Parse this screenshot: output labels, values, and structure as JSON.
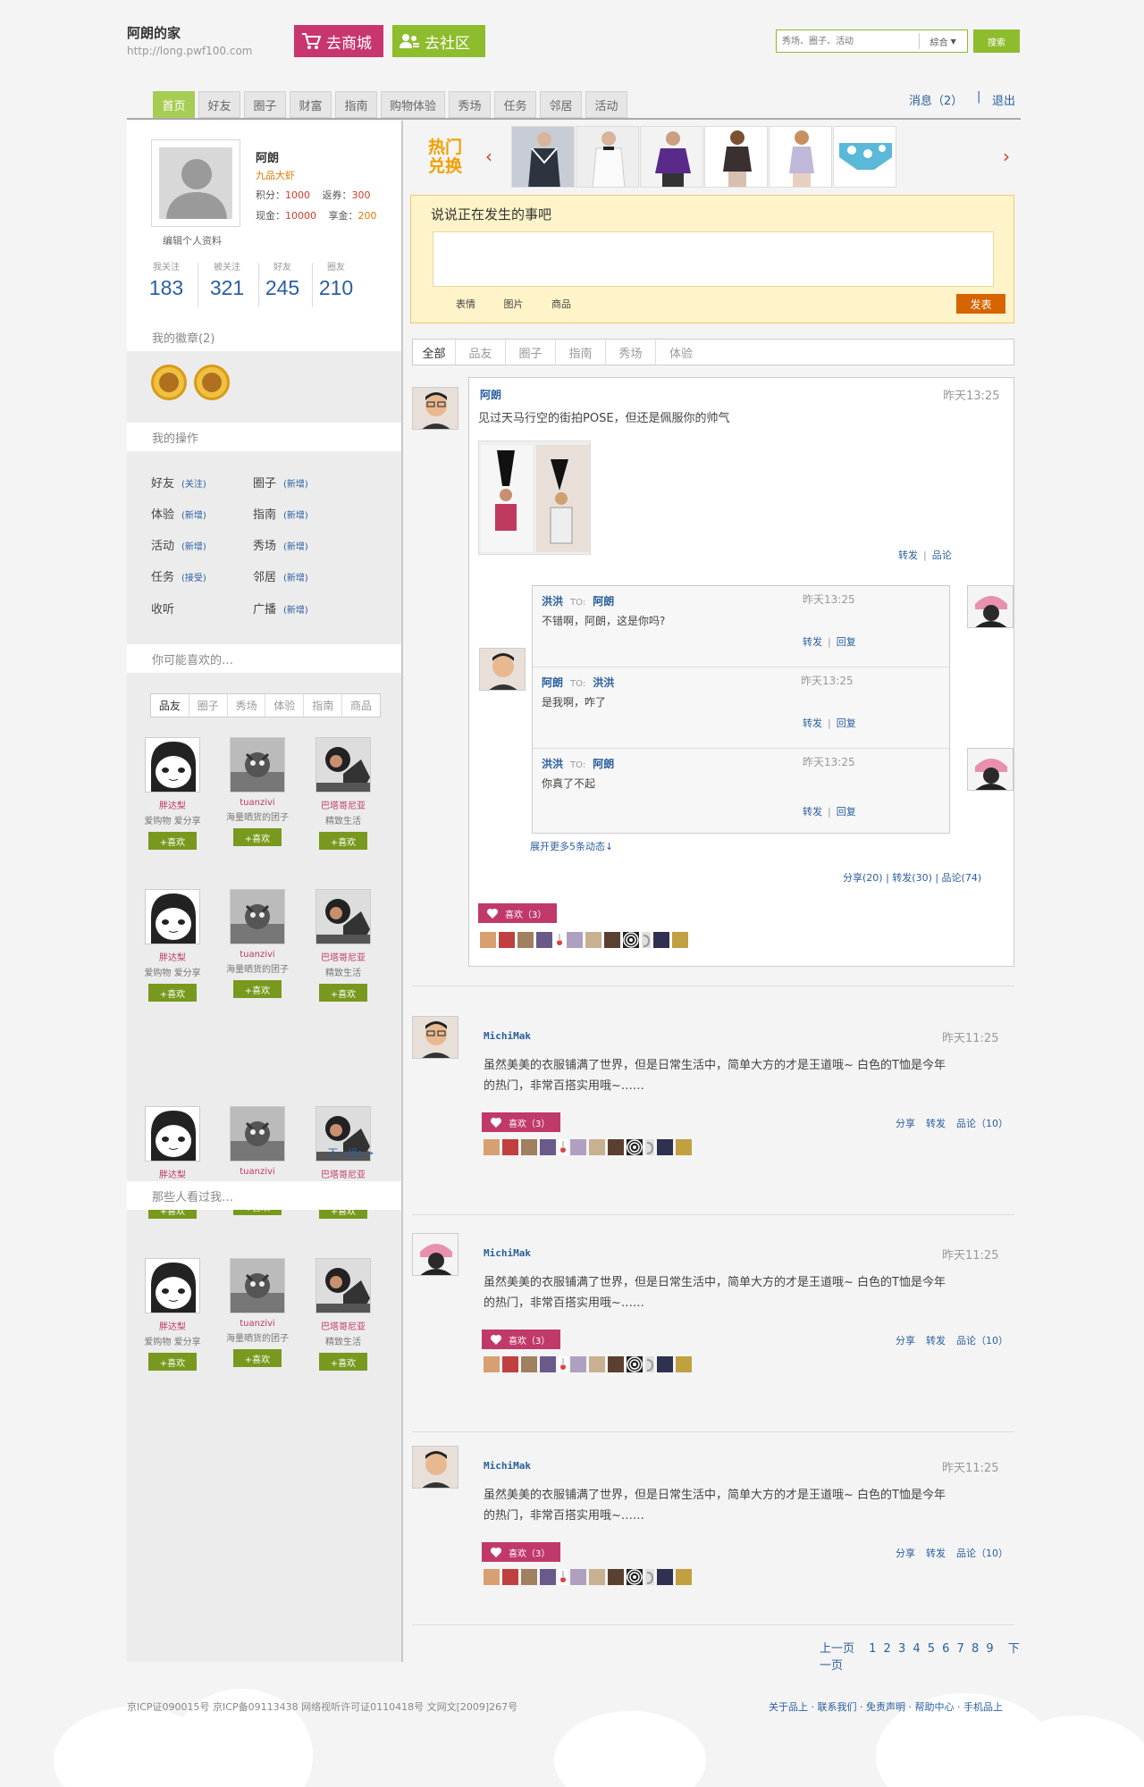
{
  "header": {
    "site_title": "阿朗的家",
    "site_url": "http://long.pwf100.com",
    "mall_button": "去商城",
    "community_button": "去社区",
    "search_placeholder": "秀场、圈子、活动",
    "search_scope": "綜合",
    "search_button": "搜索",
    "messages": "消息（2）",
    "separator": "|",
    "logout": "退出"
  },
  "nav": {
    "tabs": [
      "首页",
      "好友",
      "圈子",
      "财富",
      "指南",
      "购物体验",
      "秀场",
      "任务",
      "邻居",
      "活动"
    ],
    "active_index": 0
  },
  "profile": {
    "name": "阿朗",
    "level": "九品大虾",
    "points_label": "积分：",
    "points": "1000",
    "coupon_label": "返券：",
    "coupon": "300",
    "cash_label": "现金：",
    "cash": "10000",
    "enjoy_label": "享金：",
    "enjoy": "200",
    "edit_link": "编辑个人资料",
    "counts": [
      {
        "label": "我关注",
        "value": "183"
      },
      {
        "label": "被关注",
        "value": "321"
      },
      {
        "label": "好友",
        "value": "245"
      },
      {
        "label": "圈友",
        "value": "210"
      }
    ]
  },
  "sidebar": {
    "badges_title": "我的徽章(2)",
    "ops_title": "我的操作",
    "ops": [
      {
        "label": "好友",
        "action": "(关注)"
      },
      {
        "label": "圈子",
        "action": "(新增)"
      },
      {
        "label": "体验",
        "action": "(新增)"
      },
      {
        "label": "指南",
        "action": "(新增)"
      },
      {
        "label": "活动",
        "action": "(新增)"
      },
      {
        "label": "秀场",
        "action": "(新增)"
      },
      {
        "label": "任务",
        "action": "(接受)"
      },
      {
        "label": "邻居",
        "action": "(新增)"
      },
      {
        "label": "收听",
        "action": ""
      },
      {
        "label": "广播",
        "action": "(新增)"
      }
    ],
    "recommend_title": "你可能喜欢的…",
    "recommend_tabs": [
      "品友",
      "圈子",
      "秀场",
      "体验",
      "指南",
      "商品"
    ],
    "users": [
      {
        "name": "胖达梨",
        "desc": "爱购物 爱分享"
      },
      {
        "name": "tuanzivi",
        "desc": "海量晒货的团子"
      },
      {
        "name": "巴塔哥尼亚",
        "desc": "精致生活"
      }
    ],
    "like_button": "+喜欢",
    "next_group": "下一组>>",
    "visitors_title": "那些人看过我…"
  },
  "hot": {
    "label_line1": "热门",
    "label_line2": "兑换",
    "prev": "‹",
    "next": "›"
  },
  "post": {
    "title": "说说正在发生的事吧",
    "tools": [
      "表情",
      "图片",
      "商品"
    ],
    "submit": "发表"
  },
  "feed_tabs": [
    "全部",
    "品友",
    "圈子",
    "指南",
    "秀场",
    "体验"
  ],
  "feed1": {
    "author": "阿朗",
    "time": "昨天13:25",
    "text": "见过天马行空的街拍POSE，但还是佩服你的帅气",
    "forward": "转发",
    "comment": "品论",
    "replies": [
      {
        "from": "洪洪",
        "to_label": "TO:",
        "to": "阿朗",
        "time": "昨天13:25",
        "text": "不错啊，阿朗，这是你吗?"
      },
      {
        "from": "阿朗",
        "to_label": "TO:",
        "to": "洪洪",
        "time": "昨天13:25",
        "text": "是我啊，咋了"
      },
      {
        "from": "洪洪",
        "to_label": "TO:",
        "to": "阿朗",
        "time": "昨天13:25",
        "text": "你真了不起"
      }
    ],
    "reply_forward": "转发",
    "reply_reply": "回复",
    "more": "展开更多5条动态↓",
    "stats": "分享(20)  |  转发(30)  |  品论(74)",
    "like": "喜欢（3）"
  },
  "feeds": [
    {
      "author": "MichiMak",
      "time": "昨天11:25",
      "line1": "虽然美美的衣服铺满了世界，但是日常生活中，简单大方的才是王道哦~ 白色的T恤是今年",
      "line2": "的热门，非常百搭实用哦~……",
      "like": "喜欢（3）",
      "share": "分享",
      "forward": "转发",
      "comment": "品论（10）"
    },
    {
      "author": "MichiMak",
      "time": "昨天11:25",
      "line1": "虽然美美的衣服铺满了世界，但是日常生活中，简单大方的才是王道哦~ 白色的T恤是今年",
      "line2": "的热门，非常百搭实用哦~……",
      "like": "喜欢（3）",
      "share": "分享",
      "forward": "转发",
      "comment": "品论（10）"
    },
    {
      "author": "MichiMak",
      "time": "昨天11:25",
      "line1": "虽然美美的衣服铺满了世界，但是日常生活中，简单大方的才是王道哦~ 白色的T恤是今年",
      "line2": "的热门，非常百搭实用哦~……",
      "like": "喜欢（3）",
      "share": "分享",
      "forward": "转发",
      "comment": "品论（10）"
    }
  ],
  "pager": {
    "prev": "上一页",
    "pages": "1 2 3 4 5 6 7 8 9",
    "next": "下一页"
  },
  "footer": {
    "left": "京ICP证090015号  京ICP备09113438  网络视听许可证0110418号  文网文[2009]267号",
    "right": "关于品上 · 联系我们 · 免责声明 · 帮助中心 · 手机品上"
  },
  "colors": {
    "brand_green": "#8dbc2d",
    "brand_pink": "#c8366f",
    "link_blue": "#2a5f9e",
    "accent_orange": "#d66400"
  }
}
